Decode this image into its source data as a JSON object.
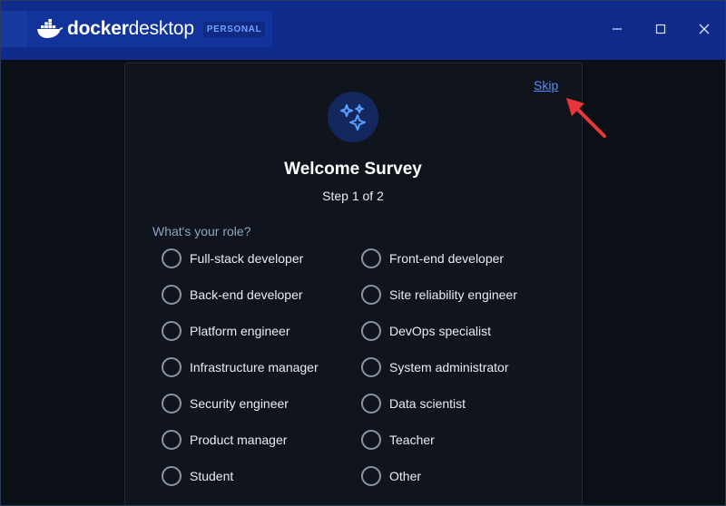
{
  "window": {
    "brand_bold": "docker",
    "brand_light": "desktop",
    "plan_badge": "PERSONAL"
  },
  "survey": {
    "skip_label": "Skip",
    "title": "Welcome Survey",
    "step": "Step 1 of 2",
    "question": "What's your role?",
    "options_left": [
      "Full-stack developer",
      "Back-end developer",
      "Platform engineer",
      "Infrastructure manager",
      "Security engineer",
      "Product manager",
      "Student"
    ],
    "options_right": [
      "Front-end developer",
      "Site reliability engineer",
      "DevOps specialist",
      "System administrator",
      "Data scientist",
      "Teacher",
      "Other"
    ]
  },
  "colors": {
    "titlebar": "#0f2c8c",
    "accent": "#4e8ff8",
    "background": "#0b0f16",
    "annotation_arrow": "#e8373a"
  },
  "icons": [
    "docker-whale-icon",
    "minimize-icon",
    "maximize-icon",
    "close-icon",
    "sparkle-icon",
    "arrow-icon"
  ]
}
